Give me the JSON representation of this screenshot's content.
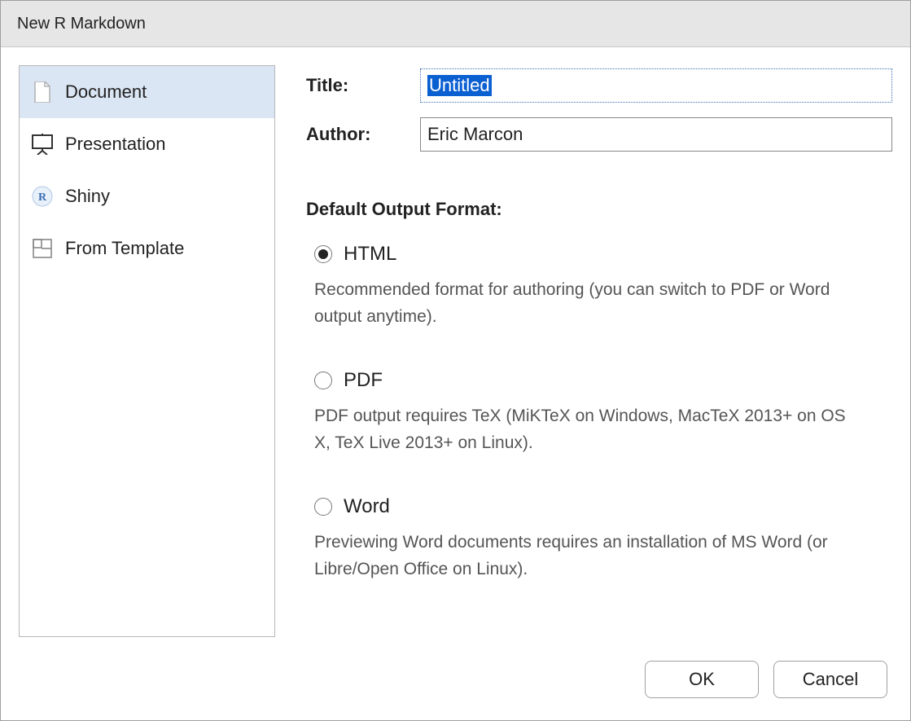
{
  "window": {
    "title": "New R Markdown"
  },
  "sidebar": {
    "items": [
      {
        "label": "Document",
        "icon": "document-icon",
        "selected": true
      },
      {
        "label": "Presentation",
        "icon": "presentation-icon",
        "selected": false
      },
      {
        "label": "Shiny",
        "icon": "shiny-r-icon",
        "selected": false
      },
      {
        "label": "From Template",
        "icon": "template-icon",
        "selected": false
      }
    ]
  },
  "form": {
    "title_label": "Title:",
    "title_value": "Untitled",
    "author_label": "Author:",
    "author_value": "Eric Marcon"
  },
  "output": {
    "heading": "Default Output Format:",
    "options": [
      {
        "label": "HTML",
        "selected": true,
        "desc": "Recommended format for authoring (you can switch to PDF or Word output anytime)."
      },
      {
        "label": "PDF",
        "selected": false,
        "desc": "PDF output requires TeX (MiKTeX on Windows, MacTeX 2013+ on OS X, TeX Live 2013+ on Linux)."
      },
      {
        "label": "Word",
        "selected": false,
        "desc": "Previewing Word documents requires an installation of MS Word (or Libre/Open Office on Linux)."
      }
    ]
  },
  "buttons": {
    "ok": "OK",
    "cancel": "Cancel"
  }
}
